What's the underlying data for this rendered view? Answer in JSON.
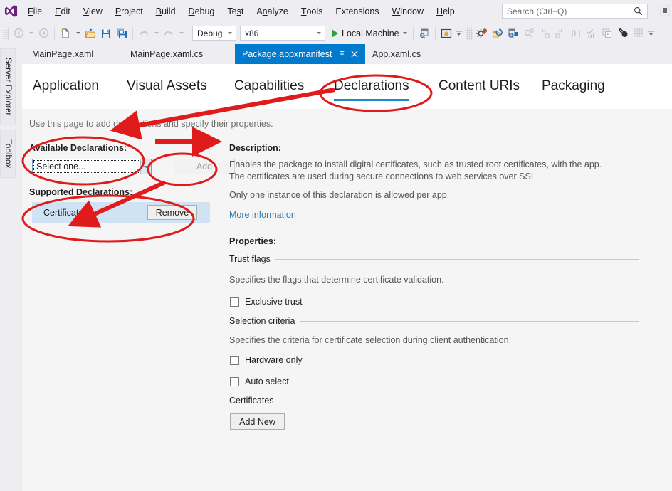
{
  "app": {
    "logo_icon": "visual-studio-logo-icon"
  },
  "menubar": {
    "items": [
      {
        "label": "File",
        "accel": "F"
      },
      {
        "label": "Edit",
        "accel": "E"
      },
      {
        "label": "View",
        "accel": "V"
      },
      {
        "label": "Project",
        "accel": "P"
      },
      {
        "label": "Build",
        "accel": "B"
      },
      {
        "label": "Debug",
        "accel": "D"
      },
      {
        "label": "Test",
        "accel": "s"
      },
      {
        "label": "Analyze",
        "accel": "n"
      },
      {
        "label": "Tools",
        "accel": "T"
      },
      {
        "label": "Extensions",
        "accel": "X"
      },
      {
        "label": "Window",
        "accel": "W"
      },
      {
        "label": "Help",
        "accel": "H"
      }
    ],
    "search": {
      "placeholder": "Search (Ctrl+Q)",
      "icon": "search-magnifier-icon"
    },
    "edge_icon": "partial-cut-off-icon"
  },
  "toolbar": {
    "nav_back_icon": "navigate-back-icon",
    "nav_forward_icon": "navigate-forward-icon",
    "new_project_icon": "new-project-icon",
    "open_file_icon": "open-file-folder-icon",
    "save_icon": "save-icon",
    "save_all_icon": "save-all-icon",
    "undo_icon": "undo-icon",
    "redo_icon": "redo-icon",
    "configuration": {
      "value": "Debug",
      "dropdown_icon": "chevron-down-icon"
    },
    "platform": {
      "value": "x86",
      "dropdown_icon": "chevron-down-icon"
    },
    "start_debug": {
      "label": "Local Machine",
      "play_icon": "play-triangle-icon",
      "dropdown_icon": "chevron-down-icon"
    },
    "right_icons": [
      "find-in-window-icon",
      "home-boxed-icon",
      "overflow-chevron-icon",
      "hot-reload-icon",
      "restart-app-icon",
      "live-visual-tree-icon",
      "zoom-search-icon",
      "step-out-left-icon",
      "step-into-right-icon",
      "break-all-icon",
      "checkmark-chart-icon",
      "copy-window-icon",
      "link-circle-icon",
      "grid-table-icon",
      "overflow-chevron-icon"
    ]
  },
  "left_dock": {
    "tabs": [
      {
        "label": "Server Explorer"
      },
      {
        "label": "Toolbox"
      }
    ]
  },
  "doc_tabs": [
    {
      "label": "MainPage.xaml",
      "active": false
    },
    {
      "label": "MainPage.xaml.cs",
      "active": false
    },
    {
      "label": "Package.appxmanifest",
      "active": true,
      "pin_icon": "pin-icon",
      "close_icon": "close-x-icon"
    },
    {
      "label": "App.xaml.cs",
      "active": false
    }
  ],
  "designer": {
    "nav_tabs": [
      {
        "label": "Application",
        "selected": false
      },
      {
        "label": "Visual Assets",
        "selected": false
      },
      {
        "label": "Capabilities",
        "selected": false
      },
      {
        "label": "Declarations",
        "selected": true
      },
      {
        "label": "Content URIs",
        "selected": false
      },
      {
        "label": "Packaging",
        "selected": false
      }
    ],
    "hint": "Use this page to add declarations and specify their properties.",
    "left": {
      "available_label": "Available Declarations:",
      "combo_value": "Select one...",
      "combo_dropdown_icon": "chevron-down-icon",
      "add_button": "Add",
      "add_button_disabled": true,
      "supported_label": "Supported Declarations:",
      "supported_items": [
        {
          "name": "Certificates",
          "remove_button": "Remove",
          "selected": true
        }
      ]
    },
    "right": {
      "description_label": "Description:",
      "description_lines": [
        "Enables the package to install digital certificates, such as trusted root certificates, with the app.",
        "The certificates are used during secure connections to web services over SSL."
      ],
      "description_note": "Only one instance of this declaration is allowed per app.",
      "more_information_link": "More information",
      "properties_label": "Properties:",
      "groups": [
        {
          "title": "Trust flags",
          "description": "Specifies the flags that determine certificate validation.",
          "checkboxes": [
            {
              "label": "Exclusive trust",
              "checked": false
            }
          ]
        },
        {
          "title": "Selection criteria",
          "description": "Specifies the criteria for certificate selection during client authentication.",
          "checkboxes": [
            {
              "label": "Hardware only",
              "checked": false
            },
            {
              "label": "Auto select",
              "checked": false
            }
          ]
        },
        {
          "title": "Certificates",
          "description": "",
          "button": "Add New"
        }
      ]
    }
  },
  "annotations": {
    "color": "#e01b1b",
    "shapes": [
      {
        "kind": "ellipse",
        "target": "declarations-tab"
      },
      {
        "kind": "ellipse",
        "target": "available-declarations-label-and-combo"
      },
      {
        "kind": "ellipse",
        "target": "add-button"
      },
      {
        "kind": "ellipse",
        "target": "certificates-row"
      },
      {
        "kind": "arrow",
        "target": "from-declarations-tab-to-hint-text"
      },
      {
        "kind": "arrow",
        "target": "short-right-arrow-toward-add"
      },
      {
        "kind": "arrow",
        "target": "from-combo-down-to-certificates-row"
      }
    ]
  },
  "colors": {
    "accent": "#007acc",
    "tab_underline": "#1b8bd0",
    "annotation_red": "#e01b1b",
    "chrome": "#eeeef2",
    "content_bg": "#f5f5f5",
    "selection_blue": "#cfe3f5",
    "link": "#2a7ab0"
  }
}
